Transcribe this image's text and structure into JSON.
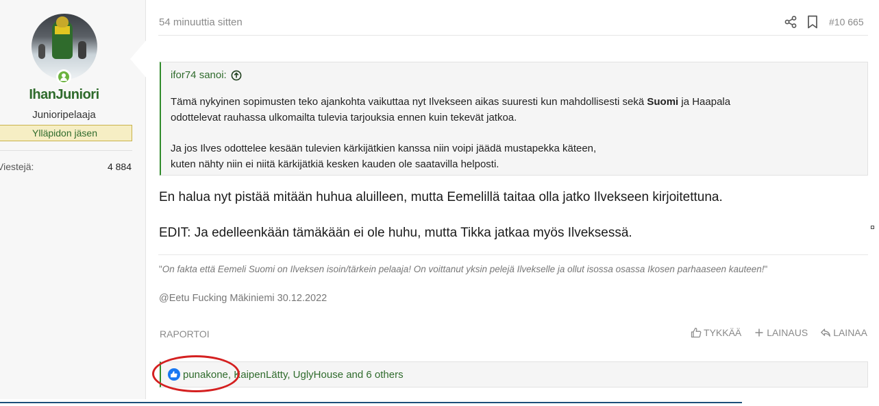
{
  "user": {
    "name": "IhanJuniori",
    "title": "Junioripelaaja",
    "banner": "Ylläpidon jäsen",
    "stat_label": "Viestejä:",
    "stat_value": "4 884"
  },
  "post": {
    "time": "54 minuuttia sitten",
    "number": "#10 665",
    "quote": {
      "author_line": "ifor74 sanoi:",
      "line1_before": "Tämä nykyinen sopimusten teko ajankohta vaikuttaa nyt Ilvekseen aikas suuresti kun mahdollisesti sekä ",
      "line1_bold": "Suomi",
      "line1_after": " ja Haapala",
      "line2": "odottelevat rauhassa ulkomailta tulevia tarjouksia ennen kuin tekevät jatkoa.",
      "line3": "Ja jos Ilves odottelee kesään tulevien kärkijätkien kanssa niin voipi jäädä mustapekka käteen,",
      "line4": "kuten nähty niin ei niitä kärkijätkiä kesken kauden ole saatavilla helposti."
    },
    "text1": "En halua nyt pistää mitään huhua aluilleen, mutta Eemelillä taitaa olla jatko Ilvekseen kirjoitettuna.",
    "text2": "EDIT: Ja edelleenkään tämäkään ei ole huhu, mutta Tikka jatkaa myös Ilveksessä.",
    "signature": {
      "open_quote": "\"",
      "quote": "On fakta että Eemeli Suomi on Ilveksen isoin/tärkein pelaaja! On voittanut yksin pelejä Ilvekselle ja ollut isossa osassa Ikosen parhaaseen kauteen!",
      "close_quote": "\"",
      "author": "@Eetu Fucking Mäkiniemi 30.12.2022"
    }
  },
  "actions": {
    "report": "RAPORTOI",
    "like": "TYKKÄÄ",
    "multiquote": "LAINAUS",
    "reply": "LAINAA"
  },
  "reactions": {
    "text": "punakone, KaipenLätty, UglyHouse and 6 others"
  },
  "colors": {
    "accent_green": "#2f6b2c",
    "highlight_red": "#d42020",
    "like_blue": "#1877f2"
  },
  "icons": [
    "share-icon",
    "bookmark-icon",
    "arrow-up-circle-icon",
    "thumbs-up-icon",
    "plus-icon",
    "reply-icon",
    "like-reaction-icon",
    "user-online-icon"
  ]
}
